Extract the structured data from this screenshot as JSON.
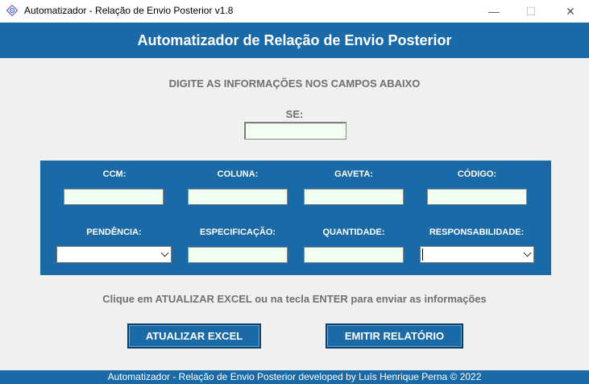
{
  "window": {
    "title": "Automatizador - Relação de Envio Posterior v1.8",
    "icon": "gear-diamond-icon",
    "minimize_glyph": "—",
    "maximize_glyph": "☐",
    "close_glyph": "✕"
  },
  "header": {
    "title": "Automatizador de Relação de Envio Posterior"
  },
  "instruction": "DIGITE AS INFORMAÇÕES NOS CAMPOS ABAIXO",
  "se": {
    "label": "SE:",
    "value": ""
  },
  "fields": {
    "ccm": {
      "label": "CCM:",
      "value": ""
    },
    "coluna": {
      "label": "COLUNA:",
      "value": ""
    },
    "gaveta": {
      "label": "GAVETA:",
      "value": ""
    },
    "codigo": {
      "label": "CÓDIGO:",
      "value": ""
    },
    "pendencia": {
      "label": "PENDÊNCIA:",
      "value": ""
    },
    "especificacao": {
      "label": "ESPECIFICAÇÃO:",
      "value": ""
    },
    "quantidade": {
      "label": "QUANTIDADE:",
      "value": ""
    },
    "responsabilidade": {
      "label": "RESPONSABILIDADE:",
      "value": ""
    }
  },
  "hint": "Clique em ATUALIZAR EXCEL ou na tecla ENTER para enviar as informações",
  "buttons": {
    "update_excel": "ATUALIZAR EXCEL",
    "emit_report": "EMITIR RELATÓRIO"
  },
  "footer": "Automatizador - Relação de Envio Posterior developed by Luís Henrique Perna © 2022",
  "colors": {
    "primary": "#1a6aa8",
    "input_bg": "#f0fff0",
    "muted_text": "#707070",
    "window_bg": "#f0f0f0"
  }
}
